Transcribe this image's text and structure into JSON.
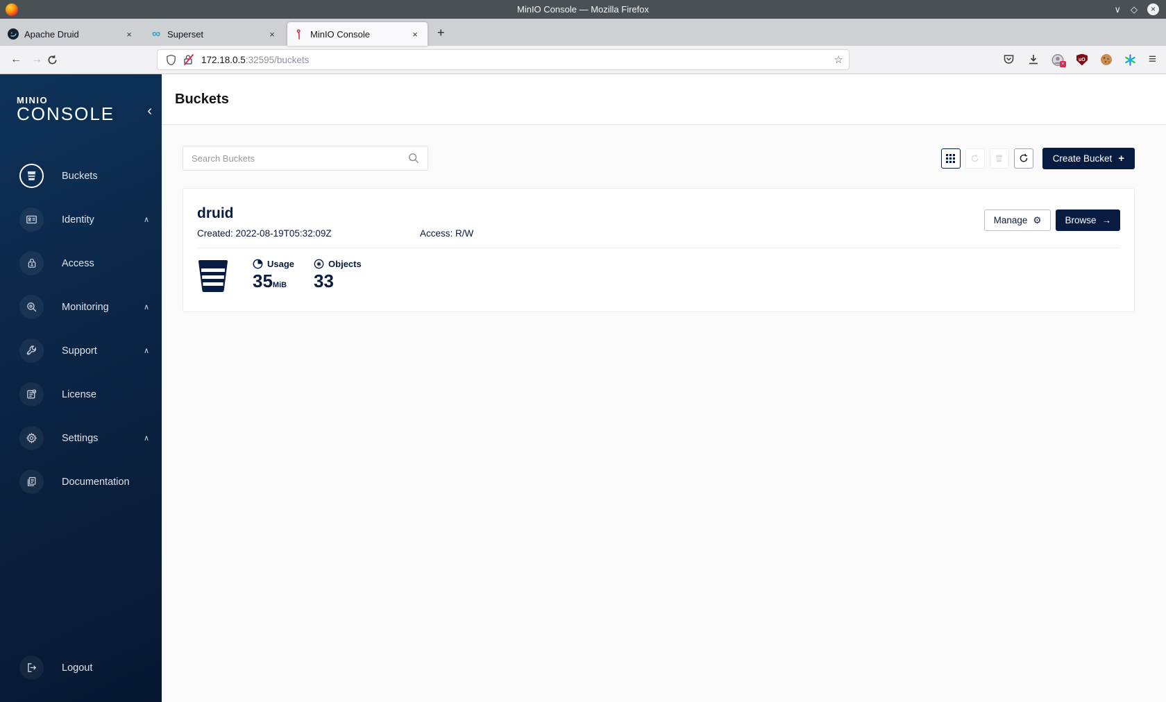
{
  "window": {
    "title": "MinIO Console — Mozilla Firefox"
  },
  "icons": {
    "minimize": "∨",
    "maximize": "◇",
    "close": "×",
    "back": "←",
    "forward": "→",
    "star": "☆",
    "infinity": "∞",
    "new_tab": "+",
    "hamburger": "≡",
    "collapse": "‹",
    "caret_up": "∧",
    "gear": "⚙",
    "plus": "+",
    "arrow_right": "→",
    "tab_close": "×",
    "account_badge": "×",
    "ublock_label": "uO"
  },
  "browser": {
    "tabs": [
      {
        "label": "Apache Druid",
        "active": false
      },
      {
        "label": "Superset",
        "active": false
      },
      {
        "label": "MinIO Console",
        "active": true
      }
    ],
    "url": {
      "host": "172.18.0.5",
      "rest": ":32595/buckets"
    }
  },
  "sidebar": {
    "logo_top": "MINIO",
    "logo_bottom": "CONSOLE",
    "items": [
      {
        "label": "Buckets"
      },
      {
        "label": "Identity"
      },
      {
        "label": "Access"
      },
      {
        "label": "Monitoring"
      },
      {
        "label": "Support"
      },
      {
        "label": "License"
      },
      {
        "label": "Settings"
      },
      {
        "label": "Documentation"
      }
    ],
    "logout_label": "Logout"
  },
  "main": {
    "page_title": "Buckets",
    "search": {
      "placeholder": "Search Buckets"
    },
    "create_bucket_label": "Create Bucket",
    "bucket": {
      "name": "druid",
      "created_label": "Created: 2022-08-19T05:32:09Z",
      "access_label": "Access: R/W",
      "usage_label": "Usage",
      "usage_value": "35",
      "usage_unit": "MiB",
      "objects_label": "Objects",
      "objects_value": "33",
      "manage_label": "Manage",
      "browse_label": "Browse"
    }
  },
  "colors": {
    "navy": "#081C42",
    "titlebar": "#4b5055",
    "tabstrip": "#cfd0d3",
    "toolbar": "#f2f2f5",
    "content-bg": "#fafafa",
    "sidebar-start": "#0e3259",
    "sidebar-end": "#071830",
    "superset-teal": "#20a7c9",
    "flamingo-red": "#c72c48",
    "ublock-red": "#7c1016"
  }
}
